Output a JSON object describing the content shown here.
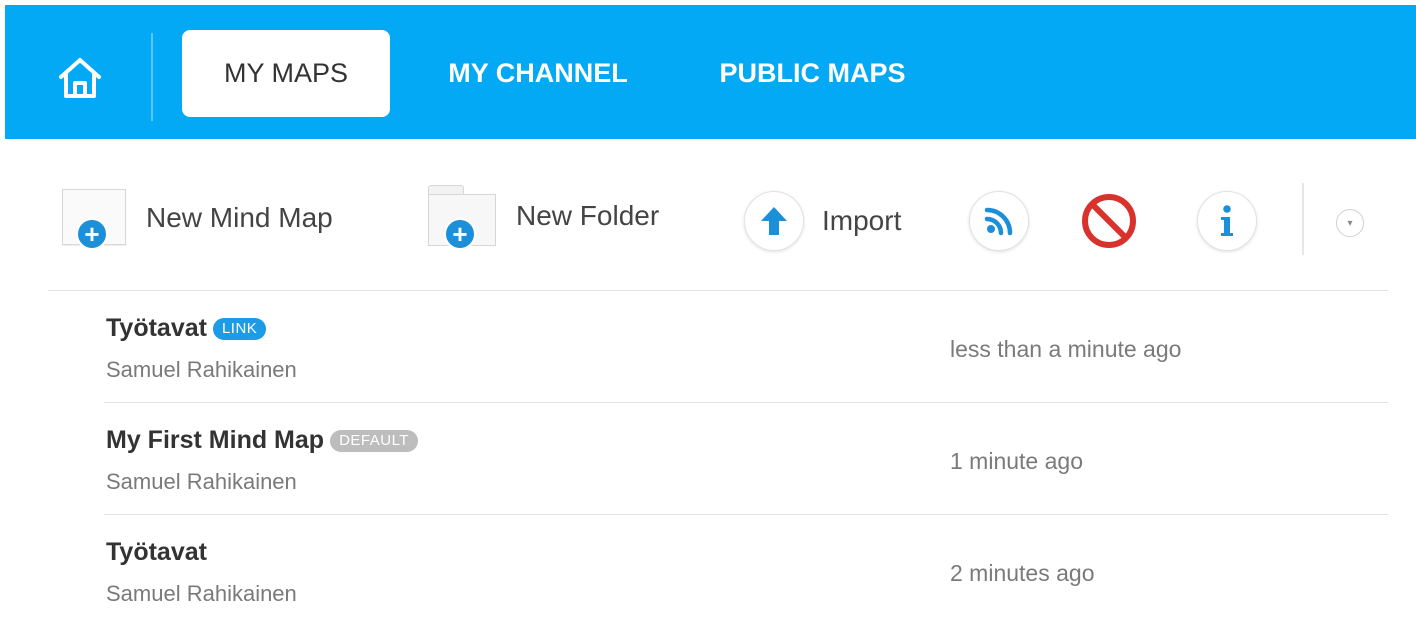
{
  "nav": {
    "home_icon": "home-icon",
    "tabs": [
      {
        "label": "MY MAPS",
        "active": true
      },
      {
        "label": "MY CHANNEL",
        "active": false
      },
      {
        "label": "PUBLIC MAPS",
        "active": false
      }
    ]
  },
  "toolbar": {
    "new_mind_map_label": "New Mind Map",
    "new_folder_label": "New Folder",
    "import_label": "Import",
    "icons": [
      "rss-icon",
      "block-icon",
      "info-icon",
      "chevron-down-icon"
    ]
  },
  "maps": [
    {
      "title": "Työtavat",
      "badge": "LINK",
      "owner": "Samuel Rahikainen",
      "modified": "less than a minute ago"
    },
    {
      "title": "My First Mind Map",
      "badge": "DEFAULT",
      "owner": "Samuel Rahikainen",
      "modified": "1 minute ago"
    },
    {
      "title": "Työtavat",
      "badge": "",
      "owner": "Samuel Rahikainen",
      "modified": "2 minutes ago"
    }
  ],
  "colors": {
    "nav_bg": "#03a9f4",
    "accent_blue": "#1b8fd8",
    "block_red": "#d9312b",
    "badge_link": "#1e9be6",
    "badge_default": "#bdbdbd"
  }
}
